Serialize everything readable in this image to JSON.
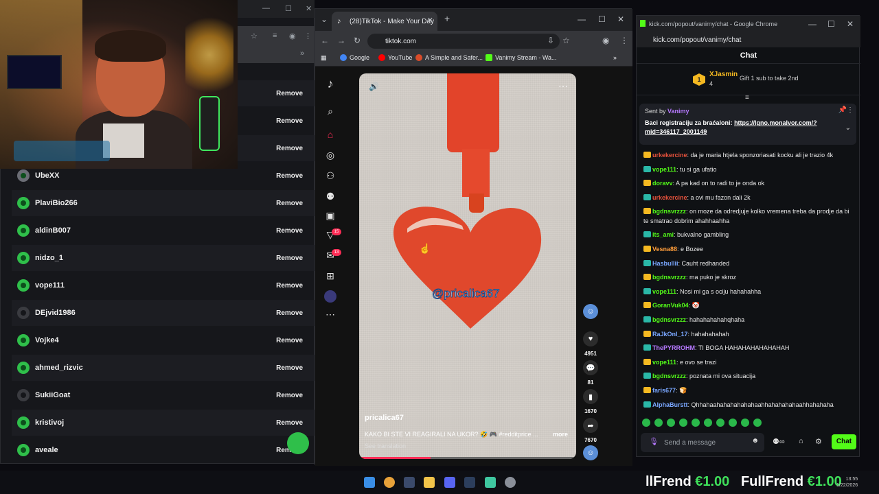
{
  "friends_window": {
    "rows": [
      {
        "name": "",
        "action": "Remove"
      },
      {
        "name": "",
        "action": "Remove"
      },
      {
        "name": "",
        "action": "Remove"
      },
      {
        "name": "UbeXX",
        "action": "Remove"
      },
      {
        "name": "PlaviBio266",
        "action": "Remove"
      },
      {
        "name": "aldinB007",
        "action": "Remove"
      },
      {
        "name": "nidzo_1",
        "action": "Remove"
      },
      {
        "name": "vope111",
        "action": "Remove"
      },
      {
        "name": "DEjvid1986",
        "action": "Remove"
      },
      {
        "name": "Vojke4",
        "action": "Remove"
      },
      {
        "name": "ahmed_rizvic",
        "action": "Remove"
      },
      {
        "name": "SukiiGoat",
        "action": "Remove"
      },
      {
        "name": "kristivoj",
        "action": "Remove"
      },
      {
        "name": "aveale",
        "action": "Remove"
      }
    ]
  },
  "tiktok_window": {
    "tab_title": "(28)TikTok - Make Your Day",
    "url": "tiktok.com",
    "bookmarks": [
      "Google",
      "YouTube",
      "A Simple and Safer...",
      "Vanimy Stream - Wa..."
    ],
    "sidebar_badges": {
      "inbox": "15",
      "messages": "13"
    },
    "video": {
      "overlay_text": "@pricalica67",
      "author": "pricalica67",
      "caption": "KAKO BI STE VI REAGIRALI NA UKOR? 🤣 🎮 #redditprice ...",
      "more_label": "more",
      "see_translation": "See translation",
      "progress": 0.33
    },
    "actions": {
      "likes": "4951",
      "comments": "81",
      "saves": "1670",
      "shares": "7670"
    }
  },
  "kick_window": {
    "window_title": "kick.com/popout/vanimy/chat - Google Chrome",
    "url": "kick.com/popout/vanimy/chat",
    "header": "Chat",
    "gift": {
      "rank": "1",
      "user": "XJasmin",
      "count": "4",
      "text": "Gift 1 sub to take 2nd"
    },
    "pinned": {
      "sent_by_label": "Sent by",
      "sender": "Vanimy",
      "text": "Baci registraciju za braćaloni: ",
      "link": "https://lgno.monalvor.com/?mid=346117_2001149"
    },
    "messages": [
      {
        "user": "urkekercine",
        "color": "#e8523c",
        "text": ": da je maria htjela sponzoriasati kocku ali je trazio 4k"
      },
      {
        "user": "vope111",
        "color": "#53fc18",
        "text": ": tu si ga ufatio"
      },
      {
        "user": "doravv",
        "color": "#53fc18",
        "text": ": A pa kad on to radi to je onda ok"
      },
      {
        "user": "urkekercine",
        "color": "#e8523c",
        "text": ": a ovi mu fazon dali 2k"
      },
      {
        "user": "bgdnsvrzzz",
        "color": "#53fc18",
        "text": ": on moze da odredjuje kolko vremena treba da prodje da bi te smatrao dobrim ahahhaahha"
      },
      {
        "user": "its_ami",
        "color": "#53fc18",
        "text": ": bukvalno gambling"
      },
      {
        "user": "Vesna88",
        "color": "#ff9d3b",
        "text": ": e Bozee"
      },
      {
        "user": "Hasbullii",
        "color": "#7aa7ff",
        "text": ": Cauht redhanded"
      },
      {
        "user": "bgdnsvrzzz",
        "color": "#53fc18",
        "text": ": ma puko je skroz"
      },
      {
        "user": "vope111",
        "color": "#53fc18",
        "text": ": Nosi mi ga s ociju hahahahha"
      },
      {
        "user": "GoranVuk04",
        "color": "#53fc18",
        "text": ": 🤡"
      },
      {
        "user": "bgdnsvrzzz",
        "color": "#53fc18",
        "text": ": hahahahahahqhaha"
      },
      {
        "user": "RaJkOnI_17",
        "color": "#7aa7ff",
        "text": ": hahahahahah"
      },
      {
        "user": "ThePYRROHM",
        "color": "#b679ff",
        "text": ": TI BOGA HAHAHAHAHAHAHAH"
      },
      {
        "user": "vope111",
        "color": "#53fc18",
        "text": ": e ovo se trazi"
      },
      {
        "user": "bgdnsvrzzz",
        "color": "#53fc18",
        "text": ": poznata mi ova situacija"
      },
      {
        "user": "faris677",
        "color": "#7aa7ff",
        "text": ": 🍞"
      },
      {
        "user": "AlphaBurstt",
        "color": "#7aa7ff",
        "text": ": Qhhahaahahahahahahaahhahahahahaahhahahaha"
      }
    ],
    "input_placeholder": "Send a message",
    "send_label": "Chat"
  },
  "ticker": {
    "name1": "llFrend",
    "price1": "€1.00",
    "name2": "FullFrend",
    "price2": "€1.00"
  },
  "clock": {
    "time": "13:55",
    "date": "1/22/2026"
  },
  "colors": {
    "kick_green": "#53fc18",
    "tiktok_red": "#fe2c55",
    "online_green": "#2fbf4a"
  }
}
